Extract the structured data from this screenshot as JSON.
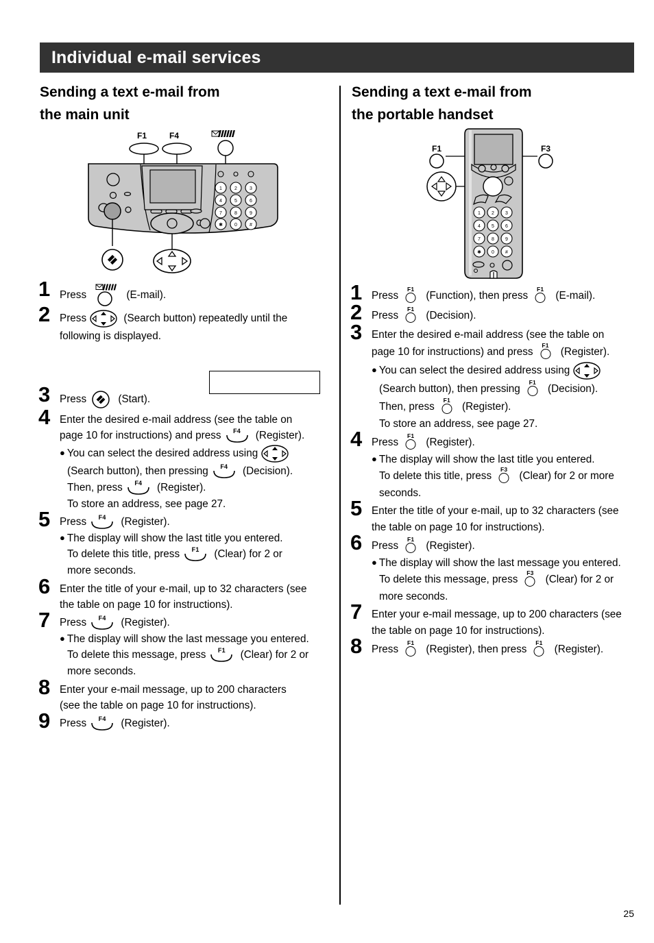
{
  "header": {
    "title": "Individual e-mail services"
  },
  "page_number": "25",
  "left_column": {
    "section_title_line1": "Sending a text e-mail from",
    "section_title_line2": "the main unit",
    "figure": {
      "name": "main-unit-fax-machine",
      "callouts": [
        {
          "label": "F1",
          "key": "f1-soft-key"
        },
        {
          "label": "F4",
          "key": "f4-soft-key"
        },
        {
          "label": "E-MAIL",
          "key": "email-key"
        }
      ],
      "keypad_rows": [
        [
          "1",
          "2",
          "3"
        ],
        [
          "4",
          "5",
          "6"
        ],
        [
          "7",
          "8",
          "9"
        ],
        [
          "✳",
          "0",
          "#"
        ]
      ]
    },
    "steps": [
      {
        "num": "1",
        "lines": [
          {
            "parts": [
              {
                "t": "text",
                "v": "Press"
              },
              {
                "t": "key",
                "style": "email",
                "label": ""
              },
              {
                "t": "text",
                "v": "(E-mail)."
              }
            ]
          }
        ]
      },
      {
        "num": "2",
        "lines": [
          {
            "parts": [
              {
                "t": "text",
                "v": "Press"
              },
              {
                "t": "key",
                "style": "nav",
                "label": ""
              },
              {
                "t": "text",
                "v": "(Search button) repeatedly until the"
              }
            ]
          },
          {
            "parts": [
              {
                "t": "text",
                "v": "following is displayed."
              }
            ]
          }
        ],
        "display_box": true
      },
      {
        "num": "3",
        "lines": [
          {
            "parts": [
              {
                "t": "text",
                "v": "Press"
              },
              {
                "t": "key",
                "style": "start",
                "label": ""
              },
              {
                "t": "text",
                "v": "(Start)."
              }
            ]
          }
        ]
      },
      {
        "num": "4",
        "lines": [
          {
            "parts": [
              {
                "t": "text",
                "v": "Enter the desired e-mail address (see the table on"
              }
            ]
          },
          {
            "parts": [
              {
                "t": "text",
                "v": "page 10 for instructions) and press"
              },
              {
                "t": "key",
                "style": "oval",
                "label": "F4"
              },
              {
                "t": "text",
                "v": "(Register)."
              }
            ]
          },
          {
            "bullet": true,
            "parts": [
              {
                "t": "text",
                "v": "You can select the desired address using"
              },
              {
                "t": "key",
                "style": "nav",
                "label": ""
              }
            ]
          },
          {
            "indent": true,
            "parts": [
              {
                "t": "text",
                "v": "(Search button), then pressing"
              },
              {
                "t": "key",
                "style": "oval",
                "label": "F4"
              },
              {
                "t": "text",
                "v": "(Decision)."
              }
            ]
          },
          {
            "indent": true,
            "parts": [
              {
                "t": "text",
                "v": "Then, press"
              },
              {
                "t": "key",
                "style": "oval",
                "label": "F4"
              },
              {
                "t": "text",
                "v": "(Register)."
              }
            ]
          },
          {
            "indent": true,
            "parts": [
              {
                "t": "text",
                "v": "To store an address, see page 27."
              }
            ]
          }
        ]
      },
      {
        "num": "5",
        "lines": [
          {
            "parts": [
              {
                "t": "text",
                "v": "Press"
              },
              {
                "t": "key",
                "style": "oval",
                "label": "F4"
              },
              {
                "t": "text",
                "v": "(Register)."
              }
            ]
          },
          {
            "bullet": true,
            "parts": [
              {
                "t": "text",
                "v": "The display will show the last title you entered."
              }
            ]
          },
          {
            "indent": true,
            "parts": [
              {
                "t": "text",
                "v": "To delete this title, press"
              },
              {
                "t": "key",
                "style": "oval",
                "label": "F1"
              },
              {
                "t": "text",
                "v": "(Clear) for 2 or"
              }
            ]
          },
          {
            "indent": true,
            "parts": [
              {
                "t": "text",
                "v": "more seconds."
              }
            ]
          }
        ]
      },
      {
        "num": "6",
        "lines": [
          {
            "parts": [
              {
                "t": "text",
                "v": "Enter the title of your e-mail, up to 32 characters (see"
              }
            ]
          },
          {
            "parts": [
              {
                "t": "text",
                "v": "the table on page 10 for instructions)."
              }
            ]
          }
        ]
      },
      {
        "num": "7",
        "lines": [
          {
            "parts": [
              {
                "t": "text",
                "v": "Press"
              },
              {
                "t": "key",
                "style": "oval",
                "label": "F4"
              },
              {
                "t": "text",
                "v": "(Register)."
              }
            ]
          },
          {
            "bullet": true,
            "parts": [
              {
                "t": "text",
                "v": "The display will show the last message you entered."
              }
            ]
          },
          {
            "indent": true,
            "parts": [
              {
                "t": "text",
                "v": "To delete this message, press"
              },
              {
                "t": "key",
                "style": "oval",
                "label": "F1"
              },
              {
                "t": "text",
                "v": "(Clear) for 2 or"
              }
            ]
          },
          {
            "indent": true,
            "parts": [
              {
                "t": "text",
                "v": "more seconds."
              }
            ]
          }
        ]
      },
      {
        "num": "8",
        "lines": [
          {
            "parts": [
              {
                "t": "text",
                "v": "Enter your e-mail message, up to 200 characters"
              }
            ]
          },
          {
            "parts": [
              {
                "t": "text",
                "v": "(see the table on page 10 for instructions)."
              }
            ]
          }
        ]
      },
      {
        "num": "9",
        "lines": [
          {
            "parts": [
              {
                "t": "text",
                "v": "Press"
              },
              {
                "t": "key",
                "style": "oval",
                "label": "F4"
              },
              {
                "t": "text",
                "v": "(Register)."
              }
            ]
          }
        ]
      }
    ]
  },
  "right_column": {
    "section_title_line1": "Sending a text e-mail from",
    "section_title_line2": "the portable handset",
    "figure": {
      "name": "portable-handset",
      "callouts": [
        {
          "label": "F1",
          "key": "f1-soft-key"
        },
        {
          "label": "F3",
          "key": "f3-soft-key"
        }
      ],
      "keypad_rows": [
        [
          "1",
          "2",
          "3"
        ],
        [
          "4",
          "5",
          "6"
        ],
        [
          "7",
          "8",
          "9"
        ],
        [
          "✳",
          "0",
          "#"
        ]
      ]
    },
    "steps": [
      {
        "num": "1",
        "lines": [
          {
            "parts": [
              {
                "t": "text",
                "v": "Press"
              },
              {
                "t": "key",
                "style": "round",
                "label": "F1"
              },
              {
                "t": "text",
                "v": "(Function), then press"
              },
              {
                "t": "key",
                "style": "round",
                "label": "F1"
              },
              {
                "t": "text",
                "v": "(E-mail)."
              }
            ]
          }
        ]
      },
      {
        "num": "2",
        "lines": [
          {
            "parts": [
              {
                "t": "text",
                "v": "Press"
              },
              {
                "t": "key",
                "style": "round",
                "label": "F1"
              },
              {
                "t": "text",
                "v": "(Decision)."
              }
            ]
          }
        ]
      },
      {
        "num": "3",
        "lines": [
          {
            "parts": [
              {
                "t": "text",
                "v": "Enter the desired e-mail address (see the table on"
              }
            ]
          },
          {
            "parts": [
              {
                "t": "text",
                "v": "page 10 for instructions) and press"
              },
              {
                "t": "key",
                "style": "round",
                "label": "F1"
              },
              {
                "t": "text",
                "v": "(Register)."
              }
            ]
          },
          {
            "bullet": true,
            "parts": [
              {
                "t": "text",
                "v": "You can select the desired address using"
              },
              {
                "t": "key",
                "style": "nav",
                "label": ""
              }
            ]
          },
          {
            "indent": true,
            "parts": [
              {
                "t": "text",
                "v": "(Search button), then pressing"
              },
              {
                "t": "key",
                "style": "round",
                "label": "F1"
              },
              {
                "t": "text",
                "v": "(Decision)."
              }
            ]
          },
          {
            "indent": true,
            "parts": [
              {
                "t": "text",
                "v": "Then, press"
              },
              {
                "t": "key",
                "style": "round",
                "label": "F1"
              },
              {
                "t": "text",
                "v": "(Register)."
              }
            ]
          },
          {
            "indent": true,
            "parts": [
              {
                "t": "text",
                "v": "To store an address, see page 27."
              }
            ]
          }
        ]
      },
      {
        "num": "4",
        "lines": [
          {
            "parts": [
              {
                "t": "text",
                "v": "Press"
              },
              {
                "t": "key",
                "style": "round",
                "label": "F1"
              },
              {
                "t": "text",
                "v": "(Register)."
              }
            ]
          },
          {
            "bullet": true,
            "parts": [
              {
                "t": "text",
                "v": "The display will show the last title you entered."
              }
            ]
          },
          {
            "indent": true,
            "parts": [
              {
                "t": "text",
                "v": "To delete this title, press"
              },
              {
                "t": "key",
                "style": "round",
                "label": "F3"
              },
              {
                "t": "text",
                "v": "(Clear) for 2 or more"
              }
            ]
          },
          {
            "indent": true,
            "parts": [
              {
                "t": "text",
                "v": "seconds."
              }
            ]
          }
        ]
      },
      {
        "num": "5",
        "lines": [
          {
            "parts": [
              {
                "t": "text",
                "v": "Enter the title of your e-mail, up to 32 characters (see"
              }
            ]
          },
          {
            "parts": [
              {
                "t": "text",
                "v": "the table on page 10 for instructions)."
              }
            ]
          }
        ]
      },
      {
        "num": "6",
        "lines": [
          {
            "parts": [
              {
                "t": "text",
                "v": "Press"
              },
              {
                "t": "key",
                "style": "round",
                "label": "F1"
              },
              {
                "t": "text",
                "v": "(Register)."
              }
            ]
          },
          {
            "bullet": true,
            "parts": [
              {
                "t": "text",
                "v": "The display will show the last message you entered."
              }
            ]
          },
          {
            "indent": true,
            "parts": [
              {
                "t": "text",
                "v": "To delete this message, press"
              },
              {
                "t": "key",
                "style": "round",
                "label": "F3"
              },
              {
                "t": "text",
                "v": "(Clear) for 2 or"
              }
            ]
          },
          {
            "indent": true,
            "parts": [
              {
                "t": "text",
                "v": "more seconds."
              }
            ]
          }
        ]
      },
      {
        "num": "7",
        "lines": [
          {
            "parts": [
              {
                "t": "text",
                "v": "Enter your e-mail message, up to 200 characters (see"
              }
            ]
          },
          {
            "parts": [
              {
                "t": "text",
                "v": "the table on page 10 for instructions)."
              }
            ]
          }
        ]
      },
      {
        "num": "8",
        "lines": [
          {
            "parts": [
              {
                "t": "text",
                "v": "Press"
              },
              {
                "t": "key",
                "style": "round",
                "label": "F1"
              },
              {
                "t": "text",
                "v": "(Register), then press"
              },
              {
                "t": "key",
                "style": "round",
                "label": "F1"
              },
              {
                "t": "text",
                "v": "(Register)."
              }
            ]
          }
        ]
      }
    ]
  },
  "colors": {
    "header_bg": "#333333",
    "header_text": "#ffffff",
    "body_text": "#000000",
    "device_fill": "#c8c8c8",
    "device_screen": "#b4b4b4"
  }
}
